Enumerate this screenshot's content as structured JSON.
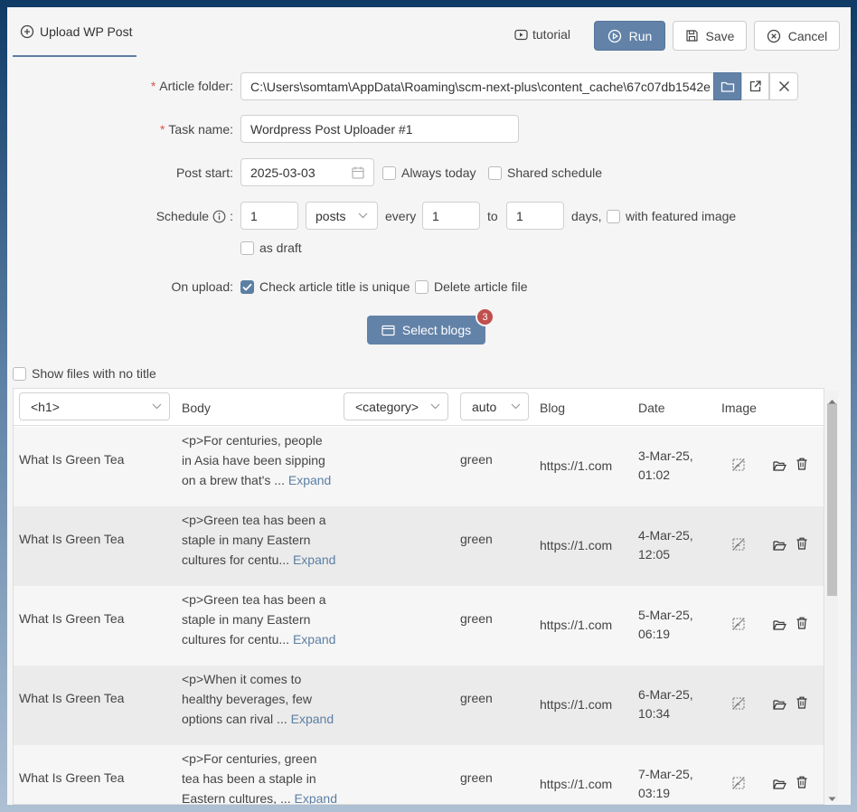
{
  "header": {
    "tab_label": "Upload WP Post",
    "tutorial_label": "tutorial",
    "run_label": "Run",
    "save_label": "Save",
    "cancel_label": "Cancel"
  },
  "form": {
    "article_folder": {
      "label": "Article folder:",
      "value": "C:\\Users\\somtam\\AppData\\Roaming\\scm-next-plus\\content_cache\\67c07db1542e"
    },
    "task_name": {
      "label": "Task name:",
      "value": "Wordpress Post Uploader #1"
    },
    "post_start": {
      "label": "Post start:",
      "value": "2025-03-03",
      "always_today": "Always today",
      "shared_schedule": "Shared schedule"
    },
    "schedule": {
      "label": "Schedule",
      "colon": ":",
      "count": "1",
      "unit": "posts",
      "every": "every",
      "from": "1",
      "to_label": "to",
      "to": "1",
      "days_label": "days,",
      "featured_image": "with featured image",
      "as_draft": "as draft"
    },
    "on_upload": {
      "label": "On upload:",
      "check_unique": "Check article title is unique",
      "check_unique_checked": true,
      "delete_file": "Delete article file"
    },
    "select_blogs": {
      "label": "Select blogs",
      "badge": "3"
    }
  },
  "show_no_title": "Show files with no title",
  "table": {
    "columns": {
      "title_select": "<h1>",
      "body": "Body",
      "category_select": "<category>",
      "tag_select": "auto",
      "blog": "Blog",
      "date": "Date",
      "image": "Image"
    },
    "rows": [
      {
        "title": "What Is Green Tea",
        "body": [
          "<p>For centuries, people",
          "in Asia have been sipping",
          "on a brew that's ..."
        ],
        "expand": "Expand",
        "tag": "green",
        "blog": "https://1.com",
        "date1": "3-Mar-25,",
        "date2": "01:02"
      },
      {
        "title": "What Is Green Tea",
        "body": [
          "<p>Green tea has been a",
          "staple in many Eastern",
          "cultures for centu..."
        ],
        "expand": "Expand",
        "tag": "green",
        "blog": "https://1.com",
        "date1": "4-Mar-25,",
        "date2": "12:05"
      },
      {
        "title": "What Is Green Tea",
        "body": [
          "<p>Green tea has been a",
          "staple in many Eastern",
          "cultures for centu..."
        ],
        "expand": "Expand",
        "tag": "green",
        "blog": "https://1.com",
        "date1": "5-Mar-25,",
        "date2": "06:19"
      },
      {
        "title": "What Is Green Tea",
        "body": [
          "<p>When it comes to",
          "healthy beverages, few",
          "options can rival ..."
        ],
        "expand": "Expand",
        "tag": "green",
        "blog": "https://1.com",
        "date1": "6-Mar-25,",
        "date2": "10:34"
      },
      {
        "title": "What Is Green Tea",
        "body": [
          "<p>For centuries, green",
          "tea has been a staple in",
          "Eastern cultures, ..."
        ],
        "expand": "Expand",
        "tag": "green",
        "blog": "https://1.com",
        "date1": "7-Mar-25,",
        "date2": "03:19"
      }
    ]
  }
}
